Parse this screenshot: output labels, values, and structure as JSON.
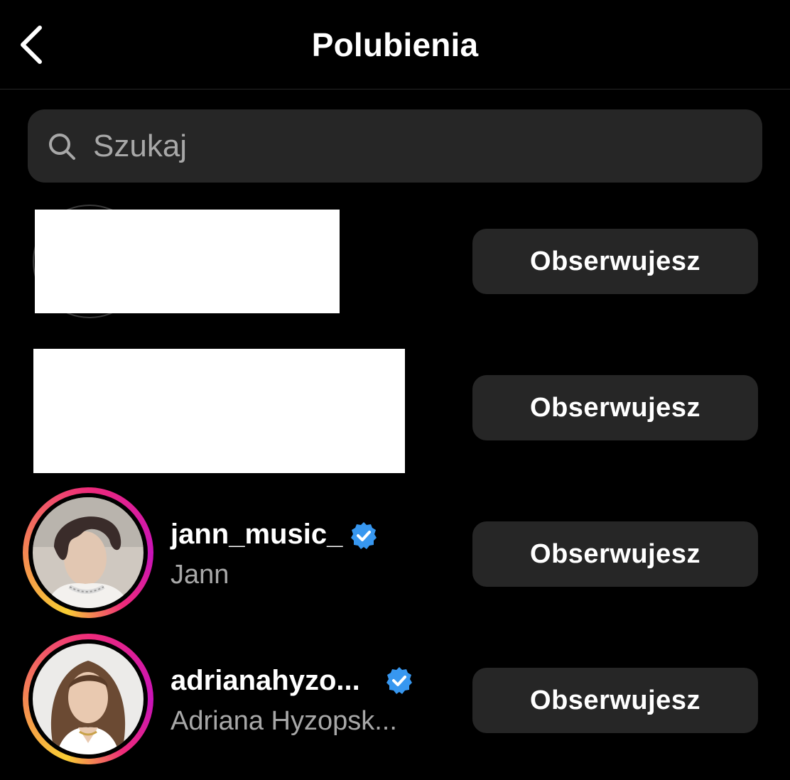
{
  "header": {
    "title": "Polubienia",
    "back_icon": "chevron-left-icon"
  },
  "search": {
    "placeholder": "Szukaj",
    "value": "",
    "icon": "search-icon"
  },
  "colors": {
    "background": "#000000",
    "surface": "#262626",
    "text_primary": "#ffffff",
    "text_secondary": "#a8a8a8",
    "verified": "#3797f0",
    "story_ring_start": "#f9ce34",
    "story_ring_mid": "#ee2a7b",
    "story_ring_end": "#c913b9"
  },
  "users": [
    {
      "username": "",
      "full_name": "",
      "verified": false,
      "redacted": true,
      "follow_label": "Obserwujesz"
    },
    {
      "username": "",
      "full_name": "",
      "verified": false,
      "redacted": true,
      "follow_label": "Obserwujesz"
    },
    {
      "username": "jann_music_",
      "full_name": "Jann",
      "verified": true,
      "story_ring": true,
      "redacted": false,
      "follow_label": "Obserwujesz"
    },
    {
      "username": "adrianahyzo...",
      "full_name": "Adriana Hyzopsk...",
      "verified": true,
      "story_ring": true,
      "redacted": false,
      "follow_label": "Obserwujesz"
    }
  ]
}
